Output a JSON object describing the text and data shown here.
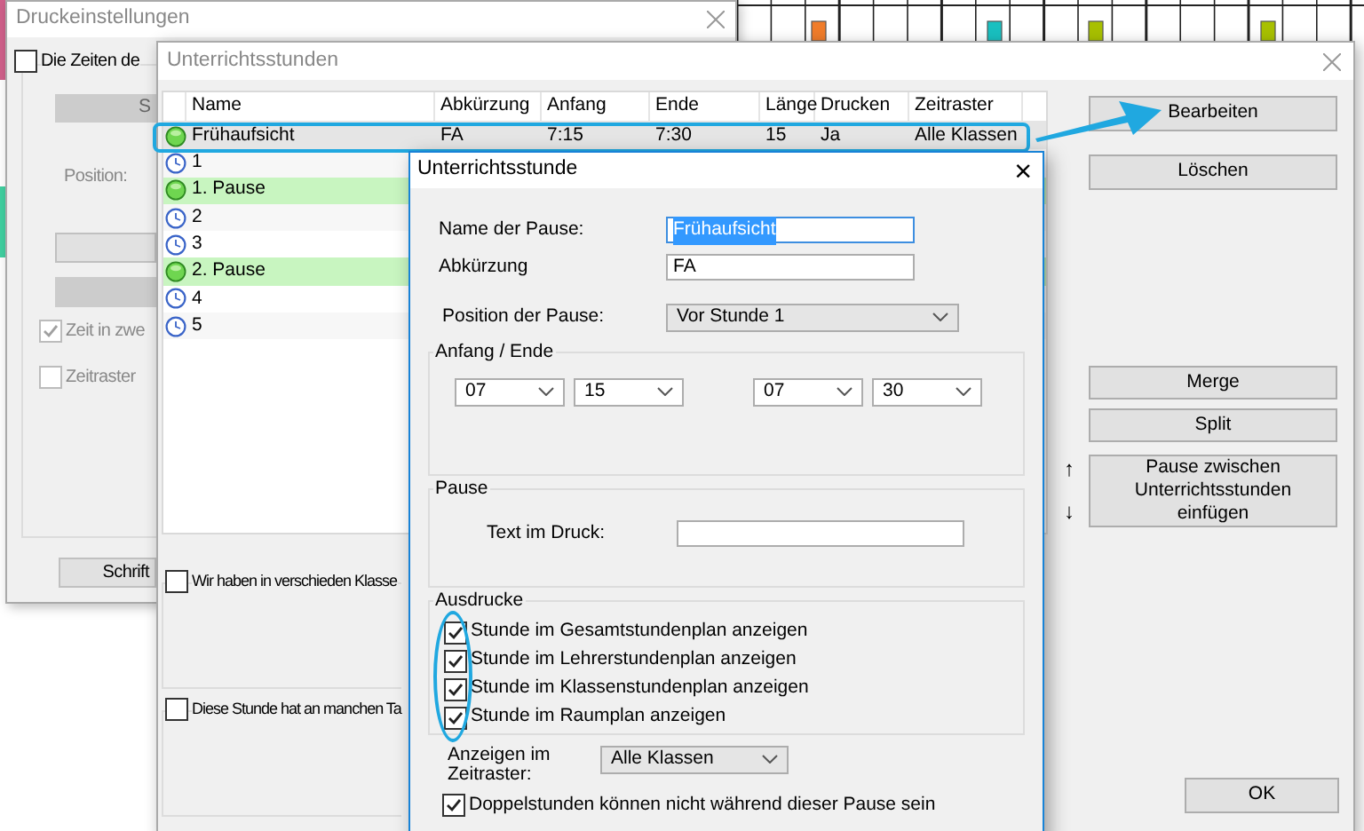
{
  "timetable_background": {
    "bars": [
      {
        "color": "#f07c2a"
      },
      {
        "color": "#19c0c0"
      },
      {
        "color": "#a8c000"
      },
      {
        "color": "#a8c000"
      }
    ]
  },
  "print_settings": {
    "title": "Druckeinstellungen",
    "times_checkbox": {
      "label": "Die Zeiten de",
      "checked": false
    },
    "first_button": "S",
    "position_label": "Position:",
    "time_checkbox": {
      "label": "Zeit in zwe",
      "checked": true,
      "disabled": true
    },
    "grid_checkbox": {
      "label": "Zeitraster",
      "checked": false,
      "disabled": true
    },
    "font_button": "Schrift"
  },
  "lessons_window": {
    "title": "Unterrichtsstunden",
    "columns": [
      "Name",
      "Abkürzung",
      "Anfang",
      "Ende",
      "Länge",
      "Drucken",
      "Zeitraster"
    ],
    "rows": [
      {
        "kind": "pause",
        "selected": true,
        "cells": [
          "Frühaufsicht",
          "FA",
          "7:15",
          "7:30",
          "15",
          "Ja",
          "Alle Klassen"
        ]
      },
      {
        "kind": "lesson",
        "selected": false,
        "cells": [
          "1"
        ]
      },
      {
        "kind": "pause",
        "selected": false,
        "cells": [
          "1. Pause"
        ]
      },
      {
        "kind": "lesson",
        "selected": false,
        "cells": [
          "2"
        ]
      },
      {
        "kind": "lesson",
        "selected": false,
        "cells": [
          "3"
        ]
      },
      {
        "kind": "pause",
        "selected": false,
        "cells": [
          "2. Pause"
        ]
      },
      {
        "kind": "lesson",
        "selected": false,
        "cells": [
          "4"
        ]
      },
      {
        "kind": "lesson",
        "selected": false,
        "cells": [
          "5"
        ]
      }
    ],
    "top_buttons": [
      "Bearbeiten",
      "Löschen"
    ],
    "lower_buttons": [
      "Merge",
      "Split",
      "Pause zwischen Unterrichtsstunden einfügen"
    ],
    "move_up": "↑",
    "move_down": "↓",
    "ok_button": "OK",
    "classes_checkbox": {
      "label": "Wir haben in verschieden Klasse",
      "checked": false
    },
    "days_checkbox": {
      "label": "Diese Stunde hat an manchen Ta",
      "checked": false
    }
  },
  "lesson_dialog": {
    "title": "Unterrichtsstunde",
    "close": "×",
    "name_label": "Name der Pause:",
    "name_value": "Frühaufsicht",
    "abbr_label": "Abkürzung",
    "abbr_value": "FA",
    "position_label": "Position der Pause:",
    "position_value": "Vor Stunde 1",
    "time_group": "Anfang / Ende",
    "times": [
      "07",
      "15",
      "07",
      "30"
    ],
    "pause_group": "Pause",
    "print_text_label": "Text im Druck:",
    "printouts_group": "Ausdrucke",
    "printouts": [
      {
        "label": "Stunde im Gesamtstundenplan anzeigen",
        "checked": true
      },
      {
        "label": "Stunde im Lehrerstundenplan anzeigen",
        "checked": true
      },
      {
        "label": "Stunde im Klassenstundenplan anzeigen",
        "checked": true
      },
      {
        "label": "Stunde im Raumplan anzeigen",
        "checked": true
      }
    ],
    "grid_label": "Anzeigen im Zeitraster:",
    "grid_value": "Alle Klassen",
    "double_checkbox": {
      "label": "Doppelstunden können nicht während dieser Pause sein",
      "checked": true
    }
  }
}
